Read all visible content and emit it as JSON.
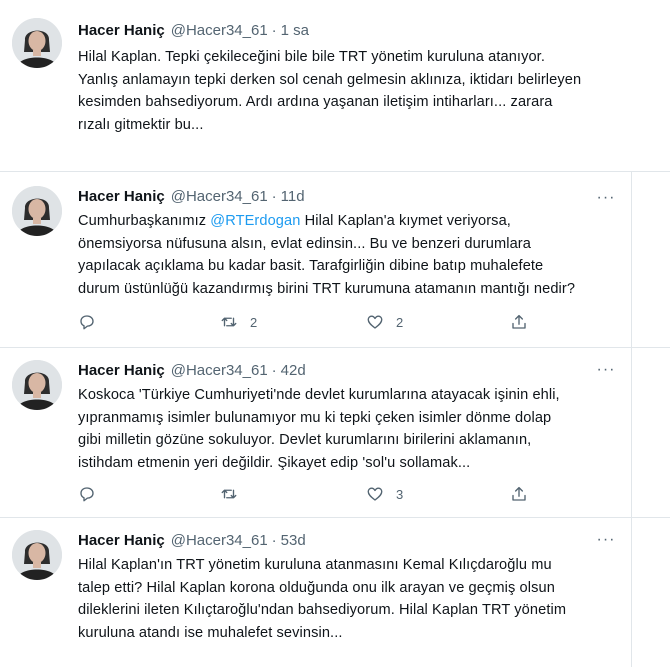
{
  "colors": {
    "text": "#0f1419",
    "muted": "#536471",
    "link": "#1d9bf0",
    "divider": "#e1e6ea"
  },
  "tweets": [
    {
      "name": "Hacer Haniç",
      "handle": "@Hacer34_61",
      "separator": "·",
      "time": "1 sa",
      "more": "···",
      "lines": [
        "Hilal Kaplan. Tepki çekileceğini bile bile TRT yönetim kuruluna atanıyor.",
        "Yanlış anlamayın tepki derken sol cenah gelmesin aklınıza, iktidarı belirleyen",
        "kesimden bahsediyorum. Ardı ardına yaşanan iletişim intiharları... zarara",
        "rızalı gitmektir bu..."
      ]
    },
    {
      "name": "Hacer Haniç",
      "handle": "@Hacer34_61",
      "separator": "·",
      "time": "11d",
      "more": "···",
      "lines": {
        "l1_pre": "Cumhurbaşkanımız ",
        "l1_mention": "@RTErdogan",
        "l1_post": " Hilal Kaplan'a kıymet veriyorsa,",
        "l2": "önemsiyorsa nüfusuna alsın, evlat edinsin... Bu ve benzeri durumlara",
        "l3": "yapılacak açıklama bu kadar basit. Tarafgirliğin dibine batıp muhalefete",
        "l4": "durum üstünlüğü kazandırmış birini TRT kurumuna atamanın mantığı nedir?"
      },
      "actions": {
        "reply_count": "",
        "retweet_count": "2",
        "like_count": "2"
      }
    },
    {
      "name": "Hacer Haniç",
      "handle": "@Hacer34_61",
      "separator": "·",
      "time": "42d",
      "more": "···",
      "lines": [
        "Koskoca 'Türkiye Cumhuriyeti'nde devlet kurumlarına atayacak işinin ehli,",
        "yıpranmamış isimler bulunamıyor mu ki tepki çeken isimler dönme dolap",
        "gibi milletin gözüne sokuluyor. Devlet kurumlarını birilerini aklamanın,",
        "istihdam etmenin yeri değildir. Şikayet edip 'sol'u sollamak..."
      ],
      "actions": {
        "reply_count": "",
        "retweet_count": "",
        "like_count": "3"
      }
    },
    {
      "name": "Hacer Haniç",
      "handle": "@Hacer34_61",
      "separator": "·",
      "time": "53d",
      "more": "···",
      "lines": [
        "Hilal Kaplan'ın TRT yönetim kuruluna atanmasını Kemal Kılıçdaroğlu mu",
        "talep etti? Hilal Kaplan korona olduğunda onu ilk arayan ve geçmiş olsun",
        "dileklerini ileten Kılıçtaroğlu'ndan bahsediyorum. Hilal Kaplan TRT yönetim",
        "kuruluna atandı ise muhalefet sevinsin..."
      ]
    }
  ]
}
